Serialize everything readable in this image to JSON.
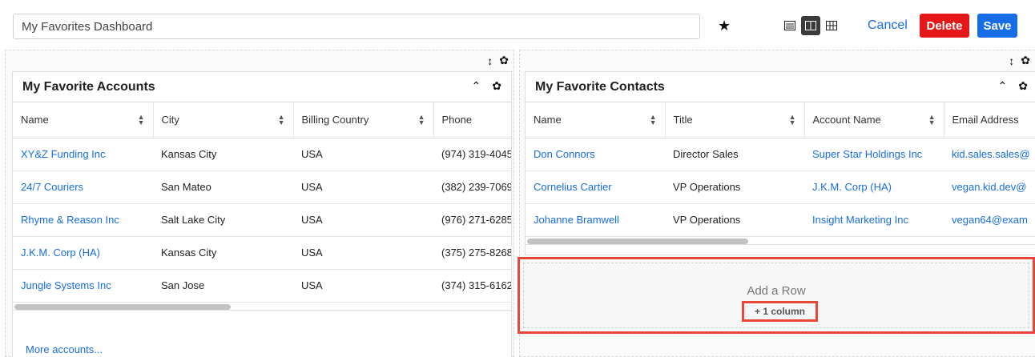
{
  "header": {
    "dashboard_name": "My Favorites Dashboard",
    "favorite_icon": "star-icon",
    "layout_views": [
      "list-view-icon",
      "two-column-view-icon",
      "grid-view-icon"
    ],
    "active_layout": "two-column-view-icon",
    "cancel_label": "Cancel",
    "delete_label": "Delete",
    "save_label": "Save",
    "colors": {
      "link": "#176de5",
      "delete": "#e61718",
      "save": "#176de5",
      "highlight": "#e8473a"
    }
  },
  "column_tools": {
    "resize_icon": "↕ resize-icon",
    "settings_icon": "gear-icon"
  },
  "accounts": {
    "title": "My Favorite Accounts",
    "columns": [
      "Name",
      "City",
      "Billing Country",
      "Phone"
    ],
    "rows": [
      [
        "XY&Z Funding Inc",
        "Kansas City",
        "USA",
        "(974) 319-4045"
      ],
      [
        "24/7 Couriers",
        "San Mateo",
        "USA",
        "(382) 239-7069"
      ],
      [
        "Rhyme & Reason Inc",
        "Salt Lake City",
        "USA",
        "(976) 271-6285"
      ],
      [
        "J.K.M. Corp (HA)",
        "Kansas City",
        "USA",
        "(375) 275-8268"
      ],
      [
        "Jungle Systems Inc",
        "San Jose",
        "USA",
        "(374) 315-6162"
      ]
    ],
    "more_label": "More accounts..."
  },
  "contacts": {
    "title": "My Favorite Contacts",
    "columns": [
      "Name",
      "Title",
      "Account Name",
      "Email Address"
    ],
    "rows": [
      [
        "Don Connors",
        "Director Sales",
        "Super Star Holdings Inc",
        "kid.sales.sales@"
      ],
      [
        "Cornelius Cartier",
        "VP Operations",
        "J.K.M. Corp (HA)",
        "vegan.kid.dev@"
      ],
      [
        "Johanne Bramwell",
        "VP Operations",
        "Insight Marketing Inc",
        "vegan64@exam"
      ]
    ]
  },
  "add_row": {
    "label": "Add a Row",
    "column_button": "+ 1 column"
  }
}
